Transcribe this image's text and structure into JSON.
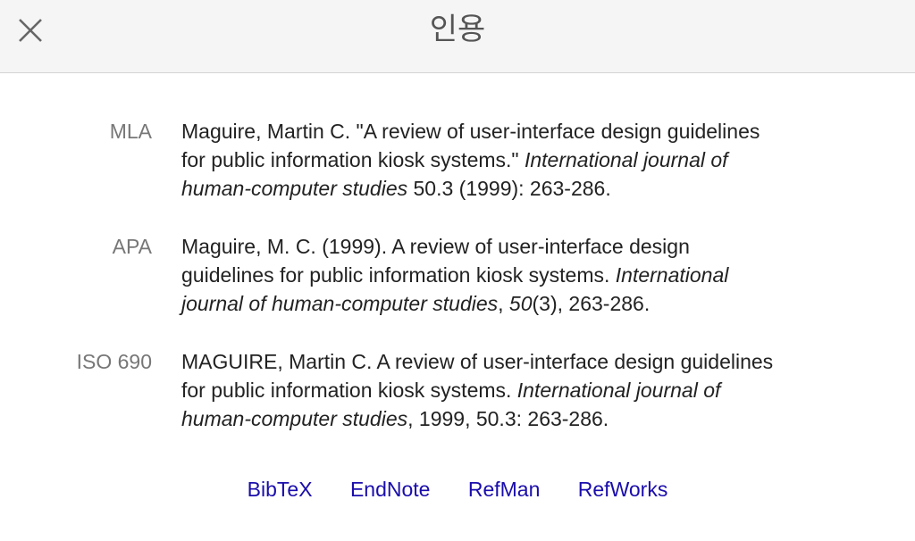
{
  "header": {
    "title": "인용",
    "close_icon": "close-icon"
  },
  "citations": [
    {
      "label": "MLA",
      "lines": [
        [
          {
            "t": "Maguire, Martin C. \"A review of user-interface design guidelines",
            "i": false
          }
        ],
        [
          {
            "t": "for public information kiosk systems.\" ",
            "i": false
          },
          {
            "t": "International journal of",
            "i": true
          }
        ],
        [
          {
            "t": "human-computer studies",
            "i": true
          },
          {
            "t": " 50.3 (1999): 263-286.",
            "i": false
          }
        ]
      ]
    },
    {
      "label": "APA",
      "lines": [
        [
          {
            "t": "Maguire, M. C. (1999). A review of user-interface design",
            "i": false
          }
        ],
        [
          {
            "t": "guidelines for public information kiosk systems. ",
            "i": false
          },
          {
            "t": "International",
            "i": true
          }
        ],
        [
          {
            "t": "journal of human-computer studies",
            "i": true
          },
          {
            "t": ", ",
            "i": false
          },
          {
            "t": "50",
            "i": true
          },
          {
            "t": "(3), 263-286.",
            "i": false
          }
        ]
      ]
    },
    {
      "label": "ISO 690",
      "lines": [
        [
          {
            "t": "MAGUIRE, Martin C. A review of user-interface design guidelines",
            "i": false
          }
        ],
        [
          {
            "t": "for public information kiosk systems. ",
            "i": false
          },
          {
            "t": "International journal of",
            "i": true
          }
        ],
        [
          {
            "t": "human-computer studies",
            "i": true
          },
          {
            "t": ", 1999, 50.3: 263-286.",
            "i": false
          }
        ]
      ]
    }
  ],
  "formats": {
    "bibtex": "BibTeX",
    "endnote": "EndNote",
    "refman": "RefMan",
    "refworks": "RefWorks",
    "link_color": "#1a0dab"
  }
}
